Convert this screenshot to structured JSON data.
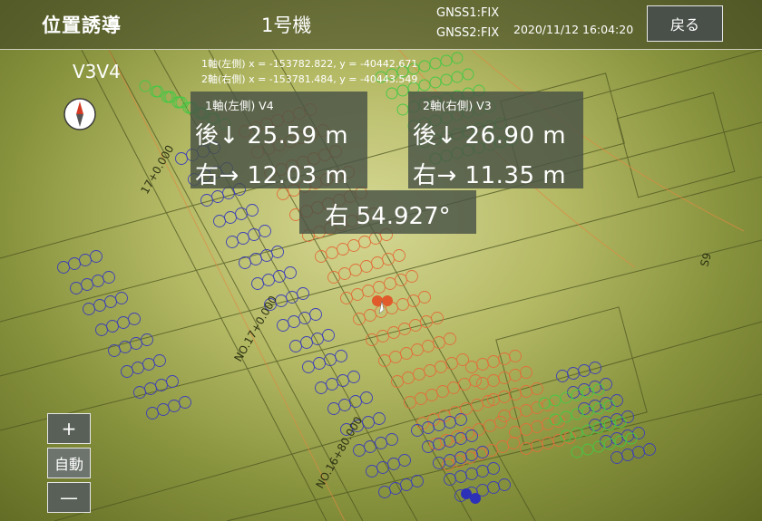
{
  "header": {
    "title": "位置誘導",
    "machine": "1号機",
    "gnss1": "GNSS1:FIX",
    "gnss2": "GNSS2:FIX",
    "datetime": "2020/11/12 16:04:20",
    "back_label": "戻る"
  },
  "mode_label": "V3V4",
  "coords": {
    "axis1": "1軸(左側) x = -153782.822, y = -40442.671",
    "axis2": "2軸(右側) x = -153781.484, y = -40443.549"
  },
  "left_panel": {
    "title": "1軸(左側) V4",
    "row1": "後↓ 25.59 m",
    "row2": "右→ 12.03 m"
  },
  "right_panel": {
    "title": "2軸(右側) V3",
    "row1": "後↓ 26.90 m",
    "row2": "右→ 11.35 m"
  },
  "angle": "右 54.927°",
  "zoom": {
    "plus": "+",
    "auto": "自動",
    "minus": "—"
  },
  "map": {
    "labels": [
      "NO.17+0.000",
      "NO.16+80.000",
      "17+0.000",
      "S9"
    ]
  },
  "colors": {
    "red_pile": "#e05a2b",
    "orange_pile": "#e0703a",
    "blue_pile": "#3b3fb8",
    "green_pile": "#44c844"
  }
}
